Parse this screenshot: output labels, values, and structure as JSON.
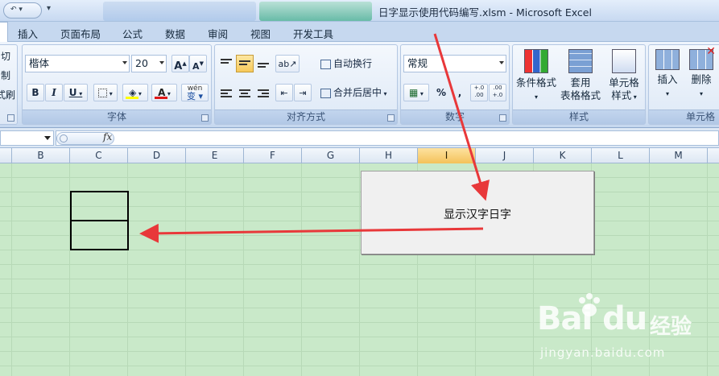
{
  "window": {
    "title": "日字显示使用代码编写.xlsm - Microsoft Excel"
  },
  "ribbon_tabs": [
    "插入",
    "页面布局",
    "公式",
    "数据",
    "审阅",
    "视图",
    "开发工具"
  ],
  "clipboard_fragments": [
    "切",
    "制",
    "式刷"
  ],
  "font_group": {
    "label": "字体",
    "font_name": "楷体",
    "font_size": "20",
    "grow_label": "A",
    "shrink_label": "A",
    "bold": "B",
    "italic": "I",
    "underline": "U",
    "font_color_label": "A",
    "phonetic_label": "wén"
  },
  "alignment_group": {
    "label": "对齐方式",
    "wrap_text": "自动换行",
    "merge_center": "合并后居中"
  },
  "number_group": {
    "label": "数字",
    "format": "常规",
    "percent": "%",
    "comma": ",",
    "inc_decimal": "+.0 .00",
    "dec_decimal": ".00 +.0"
  },
  "styles_group": {
    "label": "样式",
    "conditional": "条件格式",
    "table_format_1": "套用",
    "table_format_2": "表格格式",
    "cell_styles_1": "单元格",
    "cell_styles_2": "样式"
  },
  "cells_group": {
    "label": "单元格",
    "insert": "插入",
    "delete": "删除"
  },
  "formula_bar": {
    "fx_label": "fx",
    "name_box_value": "",
    "formula_value": ""
  },
  "columns": [
    "B",
    "C",
    "D",
    "E",
    "F",
    "G",
    "H",
    "I",
    "J",
    "K",
    "L",
    "M"
  ],
  "selected_column": "I",
  "macro_button": {
    "label": "显示汉字日字"
  },
  "colors": {
    "sheet_background": "#c9e9c9",
    "arrow": "#e8383a",
    "selected_column": "#f4c25a"
  },
  "watermark": {
    "logo": "Bai du",
    "text": "经验",
    "url": "jingyan.baidu.com"
  }
}
